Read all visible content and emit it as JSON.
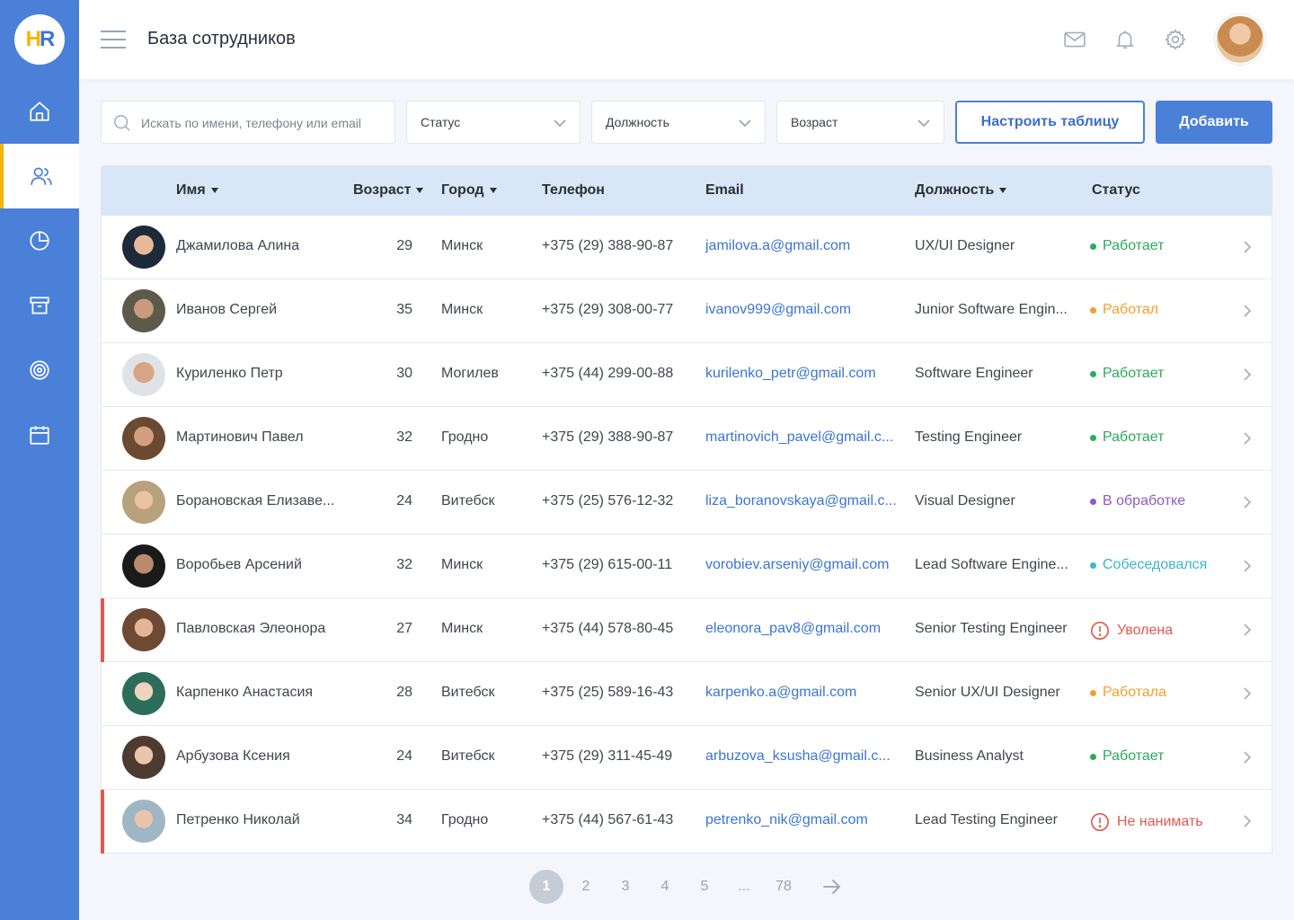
{
  "app": {
    "logo_h": "H",
    "logo_r": "R",
    "page_title": "База сотрудников"
  },
  "sidebar": {
    "items": [
      {
        "name": "home-icon",
        "active": false
      },
      {
        "name": "users-icon",
        "active": true
      },
      {
        "name": "pie-chart-icon",
        "active": false
      },
      {
        "name": "archive-icon",
        "active": false
      },
      {
        "name": "target-icon",
        "active": false
      },
      {
        "name": "calendar-icon",
        "active": false
      }
    ],
    "accent_color": "#f5b400",
    "background_color": "#4a80d8"
  },
  "header": {
    "icons": [
      "mail-icon",
      "bell-icon",
      "gear-icon"
    ]
  },
  "filters": {
    "search_placeholder": "Искать по имени, телефону или email",
    "status_label": "Статус",
    "position_label": "Должность",
    "age_label": "Возраст",
    "configure_button": "Настроить таблицу",
    "add_button": "Добавить"
  },
  "table": {
    "columns": {
      "name": "Имя",
      "age": "Возраст",
      "city": "Город",
      "phone": "Телефон",
      "email": "Email",
      "position": "Должность",
      "status": "Статус"
    },
    "rows": [
      {
        "name": "Джамилова Алина",
        "age": "29",
        "city": "Минск",
        "phone": "+375 (29) 388-90-87",
        "email": "jamilova.a@gmail.com",
        "position": "UX/UI Designer",
        "status": "Работает",
        "status_color": "#2eaa5b",
        "status_kind": "dot",
        "flag": false
      },
      {
        "name": "Иванов Сергей",
        "age": "35",
        "city": "Минск",
        "phone": "+375 (29) 308-00-77",
        "email": "ivanov999@gmail.com",
        "position": "Junior Software Engin...",
        "status": "Работал",
        "status_color": "#f0a030",
        "status_kind": "dot",
        "flag": false
      },
      {
        "name": "Куриленко Петр",
        "age": "30",
        "city": "Могилев",
        "phone": "+375 (44) 299-00-88",
        "email": "kurilenko_petr@gmail.com",
        "position": "Software Engineer",
        "status": "Работает",
        "status_color": "#2eaa5b",
        "status_kind": "dot",
        "flag": false
      },
      {
        "name": "Мартинович Павел",
        "age": "32",
        "city": "Гродно",
        "phone": "+375 (29) 388-90-87",
        "email": "martinovich_pavel@gmail.c...",
        "position": "Testing Engineer",
        "status": "Работает",
        "status_color": "#2eaa5b",
        "status_kind": "dot",
        "flag": false
      },
      {
        "name": "Борановская Елизаве...",
        "age": "24",
        "city": "Витебск",
        "phone": "+375 (25) 576-12-32",
        "email": "liza_boranovskaya@gmail.c...",
        "position": "Visual Designer",
        "status": "В обработке",
        "status_color": "#8a5bc8",
        "status_kind": "dot",
        "flag": false
      },
      {
        "name": "Воробьев Арсений",
        "age": "32",
        "city": "Минск",
        "phone": "+375 (29) 615-00-11",
        "email": "vorobiev.arseniy@gmail.com",
        "position": "Lead Software Engine...",
        "status": "Собеседовался",
        "status_color": "#3bb6c9",
        "status_kind": "dot",
        "flag": false
      },
      {
        "name": "Павловская Элеонора",
        "age": "27",
        "city": "Минск",
        "phone": "+375 (44) 578-80-45",
        "email": "eleonora_pav8@gmail.com",
        "position": "Senior Testing Engineer",
        "status": "Уволена",
        "status_color": "#e05a4f",
        "status_kind": "warn",
        "flag": true
      },
      {
        "name": "Карпенко Анастасия",
        "age": "28",
        "city": "Витебск",
        "phone": "+375 (25) 589-16-43",
        "email": "karpenko.a@gmail.com",
        "position": "Senior UX/UI Designer",
        "status": "Работала",
        "status_color": "#f0a030",
        "status_kind": "dot",
        "flag": false
      },
      {
        "name": "Арбузова Ксения",
        "age": "24",
        "city": "Витебск",
        "phone": "+375 (29) 311-45-49",
        "email": "arbuzova_ksusha@gmail.c...",
        "position": "Business Analyst",
        "status": "Работает",
        "status_color": "#2eaa5b",
        "status_kind": "dot",
        "flag": false
      },
      {
        "name": "Петренко Николай",
        "age": "34",
        "city": "Гродно",
        "phone": "+375 (44) 567-61-43",
        "email": "petrenko_nik@gmail.com",
        "position": "Lead Testing Engineer",
        "status": "Не нанимать",
        "status_color": "#e05a4f",
        "status_kind": "warn",
        "flag": true
      }
    ]
  },
  "pagination": {
    "pages": [
      "1",
      "2",
      "3",
      "4",
      "5",
      "...",
      "78"
    ],
    "current": "1"
  }
}
